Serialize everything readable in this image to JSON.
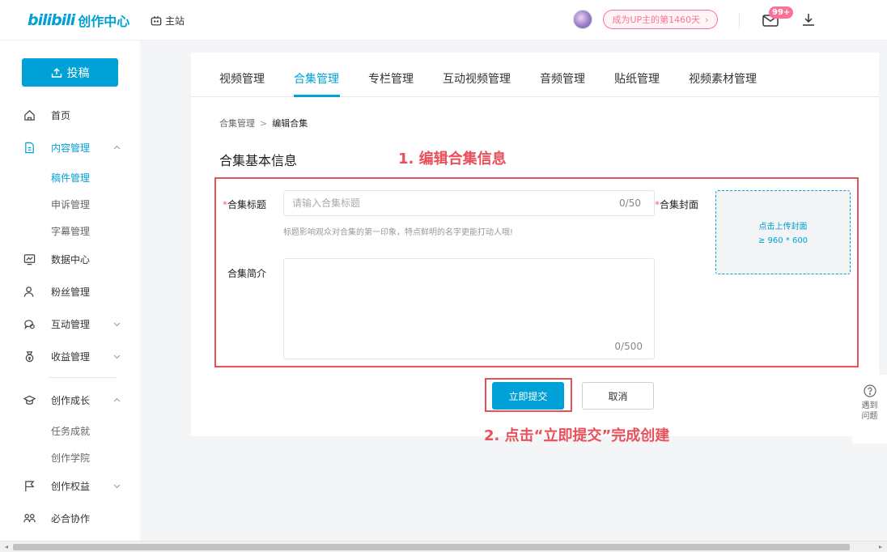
{
  "header": {
    "logo_mark": "bilibili",
    "logo_text": "创作中心",
    "home_label": "主站",
    "up_badge": "成为UP主的第1460天",
    "message_badge": "99+"
  },
  "sidebar": {
    "post_button": "投稿",
    "items": {
      "home": "首页",
      "content": "内容管理",
      "content_sub": [
        "稿件管理",
        "申诉管理",
        "字幕管理"
      ],
      "data": "数据中心",
      "fans": "粉丝管理",
      "interact": "互动管理",
      "income": "收益管理",
      "growth": "创作成长",
      "growth_sub": [
        "任务成就",
        "创作学院"
      ],
      "rights": "创作权益",
      "collab": "必合协作"
    }
  },
  "tabs": [
    "视频管理",
    "合集管理",
    "专栏管理",
    "互动视频管理",
    "音频管理",
    "贴纸管理",
    "视频素材管理"
  ],
  "active_tab": "合集管理",
  "breadcrumb": {
    "parent": "合集管理",
    "separator": ">",
    "current": "编辑合集"
  },
  "section_title": "合集基本信息",
  "form": {
    "title_label": "合集标题",
    "title_placeholder": "请输入合集标题",
    "title_value": "",
    "title_count": "0/50",
    "title_hint": "标题影响观众对合集的第一印象，特点鲜明的名字更能打动人哦!",
    "desc_label": "合集简介",
    "desc_value": "",
    "desc_count": "0/500",
    "cover_label": "合集封面",
    "cover_upload_text": "点击上传封面",
    "cover_size": "≥ 960 * 600",
    "required_mark": "*"
  },
  "actions": {
    "submit": "立即提交",
    "cancel": "取消"
  },
  "annotations": {
    "step1": "1. 编辑合集信息",
    "step2": "2. 点击“立即提交”完成创建"
  },
  "help": {
    "label": "遇到问题"
  },
  "colors": {
    "brand": "#00a1d6",
    "pink": "#fb7299",
    "annotation": "#e9505a"
  }
}
